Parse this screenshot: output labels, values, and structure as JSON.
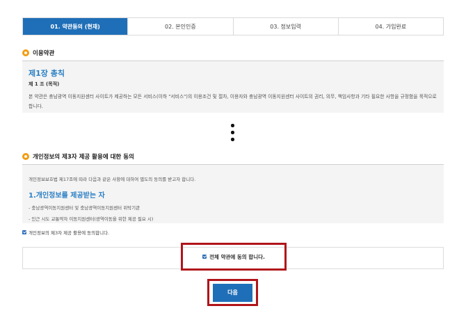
{
  "steps": [
    {
      "label": "01. 약관동의 (현재)",
      "active": true
    },
    {
      "label": "02. 본인인증",
      "active": false
    },
    {
      "label": "03. 정보입력",
      "active": false
    },
    {
      "label": "04. 가입완료",
      "active": false
    }
  ],
  "terms": {
    "section_title": "이용약관",
    "chapter": "제1장 총칙",
    "article": "제 1 조 (목적)",
    "text": "본 약관은 충남광역 이동지원센터 사이트가 제공하는 모든 서비스(이하 \"서비스\")의 이용조건 및 절차, 이용자와 충남광역 이동지원센터 사이트의 권리, 의무, 책임사항과 기타 필요한 사항을 규정함을 목적으로 합니다."
  },
  "privacy": {
    "section_title": "개인정보의 제3자 제공 활용에 대한 동의",
    "intro": "개인정보보호법 제17조에 따라 다음과 같은 사항에 대하여 별도의 동의를 받고자 합니다.",
    "heading": "1.개인정보를 제공받는 자",
    "items": [
      "- 충남광역이동지원센터 및 충남광역이동지원센터 위탁기관",
      "- 인근 시도 교통약자 이동지원센터(광역이동을 위한 제공 필요 시)"
    ],
    "agree_label": "개인정보의 제3자 제공 활용에 동의합니다."
  },
  "agree_all_label": "전체 약관에 동의 합니다.",
  "next_label": "다음",
  "colors": {
    "primary": "#1f6fb8",
    "highlight": "#b0141a",
    "title_icon": "#f39c12"
  }
}
